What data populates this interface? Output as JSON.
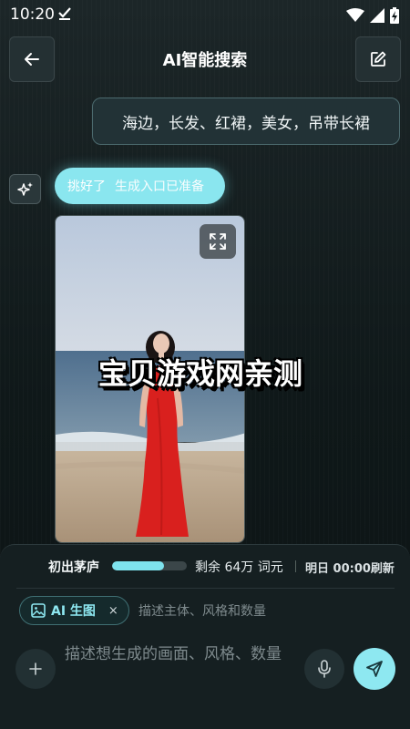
{
  "status_bar": {
    "time": "10:20",
    "icons": [
      "download-done-icon",
      "wifi-icon",
      "signal-icon",
      "battery-charging-icon"
    ]
  },
  "header": {
    "title": "AI智能搜索",
    "back_icon": "arrow-left-icon",
    "edit_icon": "edit-icon"
  },
  "chat": {
    "user_message": "海边，长发、红裙，美女，吊带长裙",
    "ai_status": {
      "label": "挑好了",
      "sub_label": "生成入口已准备"
    },
    "image": {
      "watermark": "宝贝游戏网亲测",
      "expand_icon": "expand-icon"
    }
  },
  "quota": {
    "level": "初出茅庐",
    "progress": 0.7,
    "remaining": "剩余 64万 词元",
    "refresh": "明日 00:00刷新"
  },
  "composer": {
    "mode_chip": {
      "label": "AI 生图",
      "close": "×"
    },
    "mode_hint": "描述主体、风格和数量",
    "placeholder": "描述想生成的画面、风格、数量"
  },
  "colors": {
    "accent": "#8ee8f1",
    "background": "#0d1417",
    "dress": "#d9201e"
  }
}
